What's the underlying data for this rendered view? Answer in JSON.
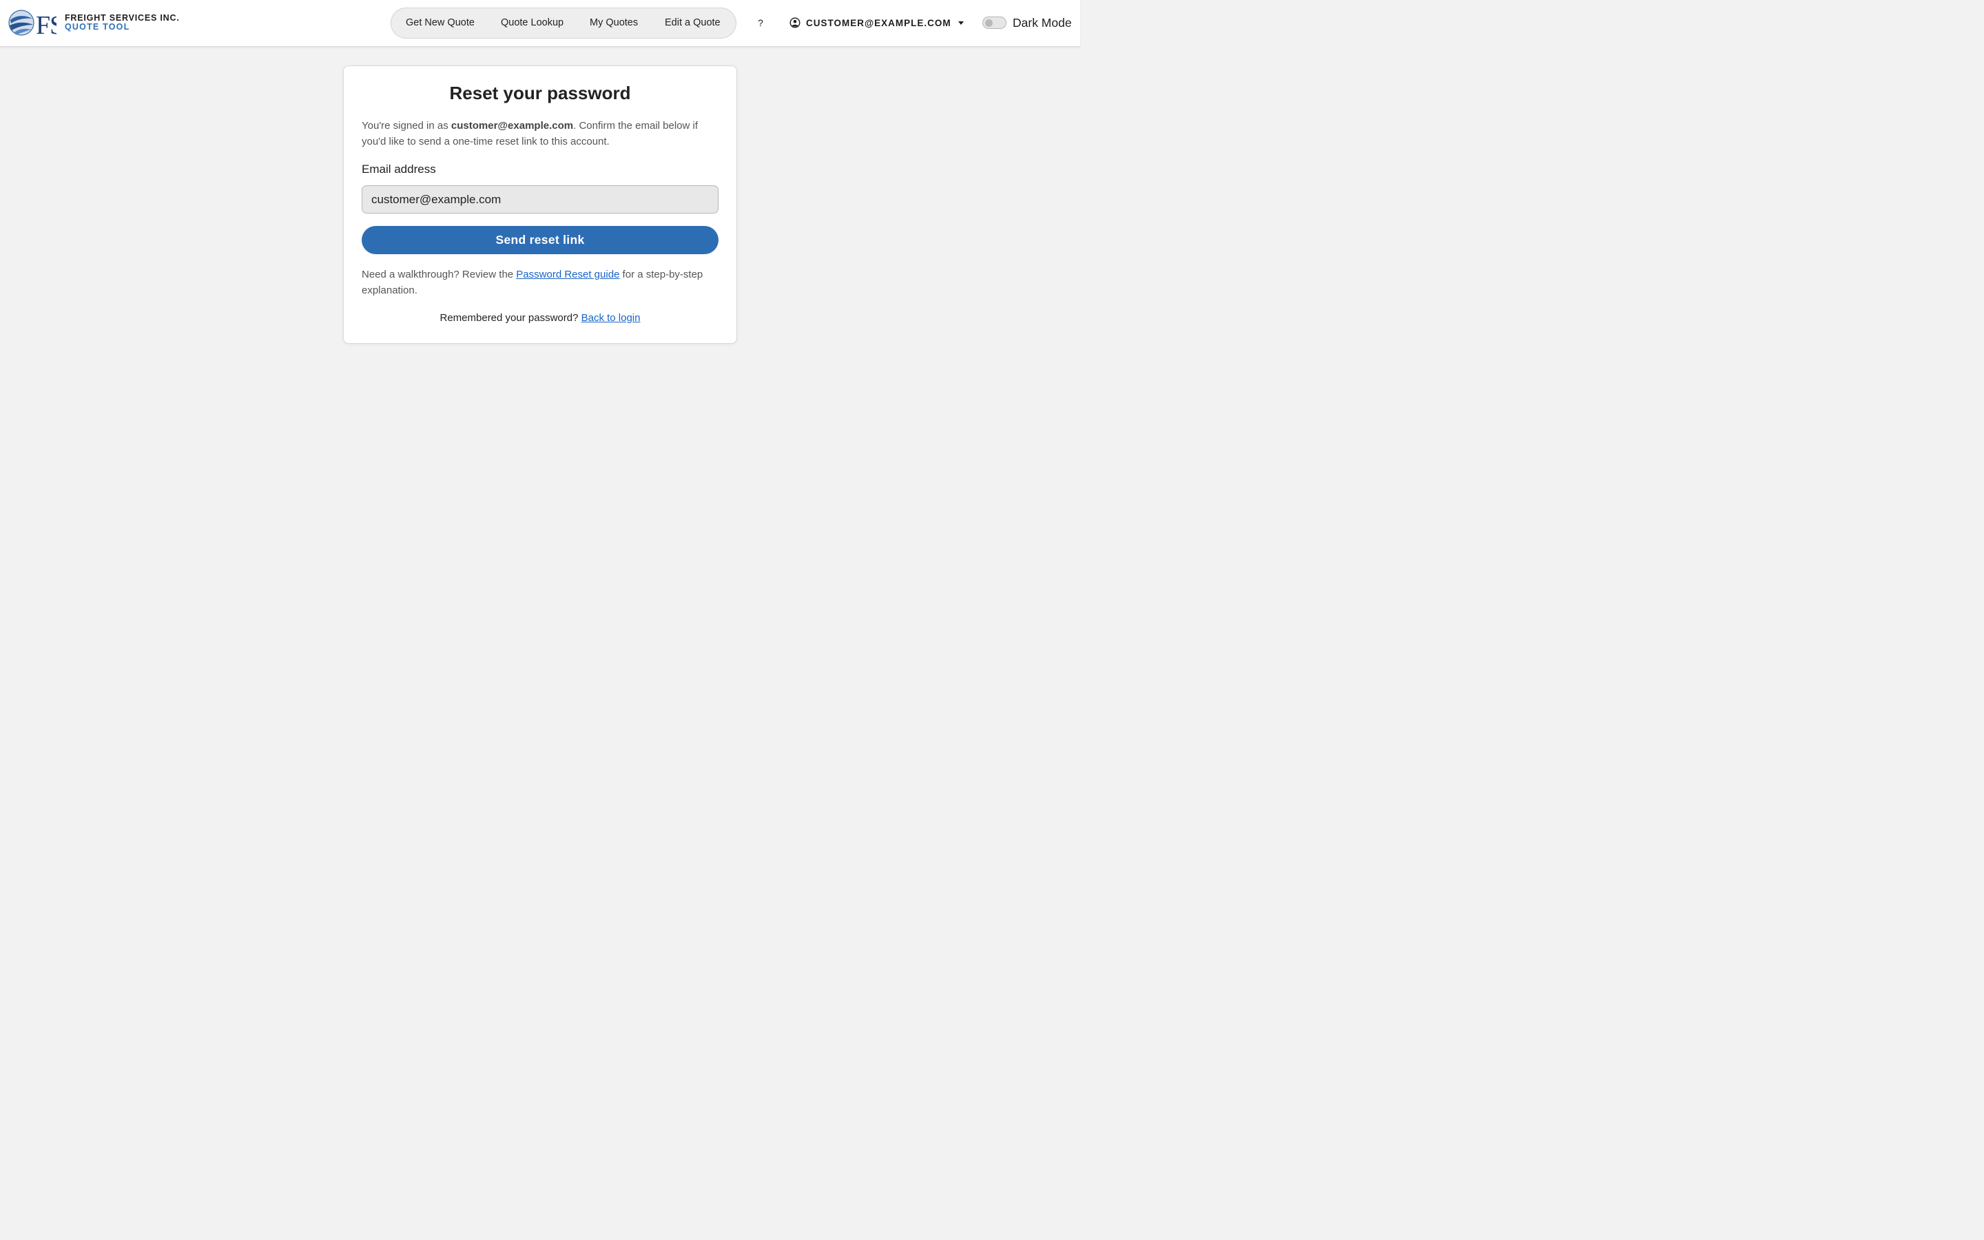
{
  "brand": {
    "name": "FREIGHT SERVICES INC.",
    "subtitle": "QUOTE TOOL",
    "logo_icon": "fsi-globe-logo"
  },
  "nav": {
    "links": [
      {
        "label": "Get New Quote"
      },
      {
        "label": "Quote Lookup"
      },
      {
        "label": "My Quotes"
      },
      {
        "label": "Edit a Quote"
      }
    ],
    "help_label": "?",
    "user": {
      "icon": "user-circle-icon",
      "label": "CUSTOMER@EXAMPLE.COM",
      "caret_icon": "caret-down-icon"
    },
    "dark_mode": {
      "label": "Dark Mode",
      "enabled": false
    }
  },
  "card": {
    "title": "Reset your password",
    "intro_prefix": "You're signed in as ",
    "intro_email": "customer@example.com",
    "intro_suffix": ". Confirm the email below if you'd like to send a one-time reset link to this account.",
    "email_label": "Email address",
    "email_value": "customer@example.com",
    "submit_label": "Send reset link",
    "guide_prefix": "Need a walkthrough? Review the ",
    "guide_link": "Password Reset guide",
    "guide_suffix": " for a step-by-step explanation.",
    "login_prefix": "Remembered your password? ",
    "login_link": "Back to login"
  },
  "colors": {
    "page_background": "#f2f2f2",
    "accent": "#2d6db4",
    "link": "#1764c8",
    "brand_subtitle": "#2d72b6"
  }
}
